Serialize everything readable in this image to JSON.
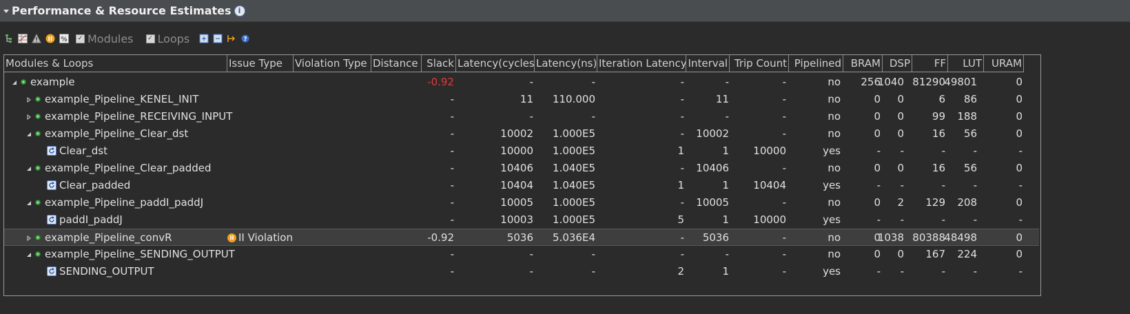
{
  "header": {
    "title": "Performance & Resource Estimates",
    "info_icon": "info-icon"
  },
  "toolbar": {
    "modules_label": "Modules",
    "loops_label": "Loops"
  },
  "columns": [
    "Modules & Loops",
    "Issue Type",
    "Violation Type",
    "Distance",
    "Slack",
    "Latency(cycles)",
    "Latency(ns)",
    "Iteration Latency",
    "Interval",
    "Trip Count",
    "Pipelined",
    "BRAM",
    "DSP",
    "FF",
    "LUT",
    "URAM"
  ],
  "rows": [
    {
      "name": "example",
      "level": 0,
      "expand": "open",
      "kind": "module",
      "issue": "",
      "violation": "",
      "distance": "",
      "slack": "-0.92",
      "slack_red": true,
      "lat_cycles": "-",
      "lat_ns": "-",
      "iter": "-",
      "interval": "-",
      "trip": "-",
      "pipelined": "no",
      "bram": "256",
      "dsp": "1040",
      "ff": "81290",
      "lut": "49801",
      "uram": "0"
    },
    {
      "name": "example_Pipeline_KENEL_INIT",
      "level": 1,
      "expand": "closed",
      "kind": "module",
      "issue": "",
      "violation": "",
      "distance": "",
      "slack": "-",
      "lat_cycles": "11",
      "lat_ns": "110.000",
      "iter": "-",
      "interval": "11",
      "trip": "-",
      "pipelined": "no",
      "bram": "0",
      "dsp": "0",
      "ff": "6",
      "lut": "86",
      "uram": "0"
    },
    {
      "name": "example_Pipeline_RECEIVING_INPUT",
      "level": 1,
      "expand": "closed",
      "kind": "module",
      "issue": "",
      "violation": "",
      "distance": "",
      "slack": "-",
      "lat_cycles": "-",
      "lat_ns": "-",
      "iter": "-",
      "interval": "-",
      "trip": "-",
      "pipelined": "no",
      "bram": "0",
      "dsp": "0",
      "ff": "99",
      "lut": "188",
      "uram": "0"
    },
    {
      "name": "example_Pipeline_Clear_dst",
      "level": 1,
      "expand": "open",
      "kind": "module",
      "issue": "",
      "violation": "",
      "distance": "",
      "slack": "-",
      "lat_cycles": "10002",
      "lat_ns": "1.000E5",
      "iter": "-",
      "interval": "10002",
      "trip": "-",
      "pipelined": "no",
      "bram": "0",
      "dsp": "0",
      "ff": "16",
      "lut": "56",
      "uram": "0"
    },
    {
      "name": "Clear_dst",
      "level": 2,
      "expand": "none",
      "kind": "loop",
      "issue": "",
      "violation": "",
      "distance": "",
      "slack": "-",
      "lat_cycles": "10000",
      "lat_ns": "1.000E5",
      "iter": "1",
      "interval": "1",
      "trip": "10000",
      "pipelined": "yes",
      "bram": "-",
      "dsp": "-",
      "ff": "-",
      "lut": "-",
      "uram": "-"
    },
    {
      "name": "example_Pipeline_Clear_padded",
      "level": 1,
      "expand": "open",
      "kind": "module",
      "issue": "",
      "violation": "",
      "distance": "",
      "slack": "-",
      "lat_cycles": "10406",
      "lat_ns": "1.040E5",
      "iter": "-",
      "interval": "10406",
      "trip": "-",
      "pipelined": "no",
      "bram": "0",
      "dsp": "0",
      "ff": "16",
      "lut": "56",
      "uram": "0"
    },
    {
      "name": "Clear_padded",
      "level": 2,
      "expand": "none",
      "kind": "loop",
      "issue": "",
      "violation": "",
      "distance": "",
      "slack": "-",
      "lat_cycles": "10404",
      "lat_ns": "1.040E5",
      "iter": "1",
      "interval": "1",
      "trip": "10404",
      "pipelined": "yes",
      "bram": "-",
      "dsp": "-",
      "ff": "-",
      "lut": "-",
      "uram": "-"
    },
    {
      "name": "example_Pipeline_paddI_paddJ",
      "level": 1,
      "expand": "open",
      "kind": "module",
      "issue": "",
      "violation": "",
      "distance": "",
      "slack": "-",
      "lat_cycles": "10005",
      "lat_ns": "1.000E5",
      "iter": "-",
      "interval": "10005",
      "trip": "-",
      "pipelined": "no",
      "bram": "0",
      "dsp": "2",
      "ff": "129",
      "lut": "208",
      "uram": "0"
    },
    {
      "name": "paddI_paddJ",
      "level": 2,
      "expand": "none",
      "kind": "loop",
      "issue": "",
      "violation": "",
      "distance": "",
      "slack": "-",
      "lat_cycles": "10003",
      "lat_ns": "1.000E5",
      "iter": "5",
      "interval": "1",
      "trip": "10000",
      "pipelined": "yes",
      "bram": "-",
      "dsp": "-",
      "ff": "-",
      "lut": "-",
      "uram": "-"
    },
    {
      "name": "example_Pipeline_convR",
      "level": 1,
      "expand": "closed",
      "kind": "module",
      "selected": true,
      "issue": "II Violation",
      "violation": "",
      "distance": "",
      "slack": "-0.92",
      "lat_cycles": "5036",
      "lat_ns": "5.036E4",
      "iter": "-",
      "interval": "5036",
      "trip": "-",
      "pipelined": "no",
      "bram": "0",
      "dsp": "1038",
      "ff": "80388",
      "lut": "48498",
      "uram": "0"
    },
    {
      "name": "example_Pipeline_SENDING_OUTPUT",
      "level": 1,
      "expand": "open",
      "kind": "module",
      "issue": "",
      "violation": "",
      "distance": "",
      "slack": "-",
      "lat_cycles": "-",
      "lat_ns": "-",
      "iter": "-",
      "interval": "-",
      "trip": "-",
      "pipelined": "no",
      "bram": "0",
      "dsp": "0",
      "ff": "167",
      "lut": "224",
      "uram": "0"
    },
    {
      "name": "SENDING_OUTPUT",
      "level": 2,
      "expand": "none",
      "kind": "loop",
      "issue": "",
      "violation": "",
      "distance": "",
      "slack": "-",
      "lat_cycles": "-",
      "lat_ns": "-",
      "iter": "2",
      "interval": "1",
      "trip": "-",
      "pipelined": "yes",
      "bram": "-",
      "dsp": "-",
      "ff": "-",
      "lut": "-",
      "uram": "-"
    }
  ]
}
